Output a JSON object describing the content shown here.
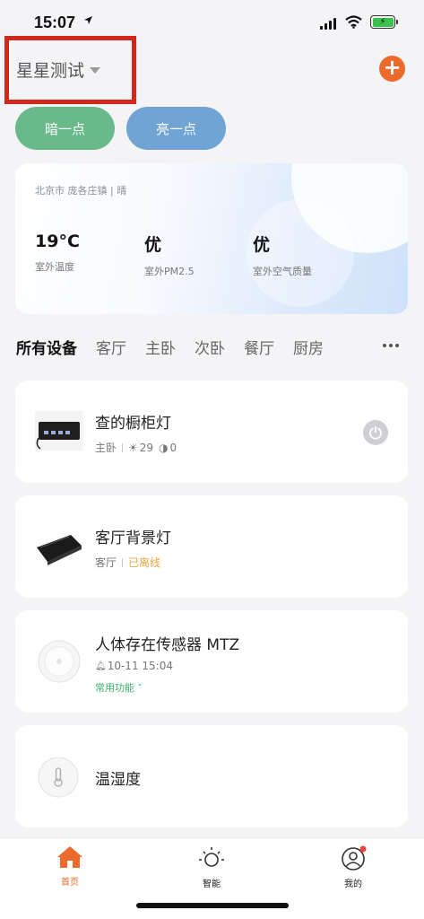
{
  "status_bar": {
    "time": "15:07"
  },
  "header": {
    "home_name": "星星测试",
    "add_icon": "+"
  },
  "scenes": {
    "dim_label": "暗一点",
    "bright_label": "亮一点"
  },
  "weather": {
    "location": "北京市 庞各庄镇 | 晴",
    "temperature": "19°C",
    "temperature_label": "室外温度",
    "pm25": "优",
    "pm25_label": "室外PM2.5",
    "air_quality": "优",
    "air_quality_label": "室外空气质量"
  },
  "rooms": [
    "所有设备",
    "客厅",
    "主卧",
    "次卧",
    "餐厅",
    "厨房"
  ],
  "devices": [
    {
      "name": "查的橱柜灯",
      "room": "主卧",
      "brightness": "29",
      "color_temp": "0"
    },
    {
      "name": "客厅背景灯",
      "room": "客厅",
      "status": "已离线"
    },
    {
      "name": "人体存在传感器 MTZ",
      "last_event": "10-11 15:04",
      "quick_link": "常用功能"
    },
    {
      "name": "温湿度"
    }
  ],
  "nav": {
    "home": "首页",
    "smart": "智能",
    "mine": "我的"
  },
  "colors": {
    "accent": "#ec6a2c",
    "dim_scene": "#6ab98a",
    "bright_scene": "#6fa4d4",
    "offline": "#e7a73d",
    "quick_link": "#3cae6e"
  }
}
